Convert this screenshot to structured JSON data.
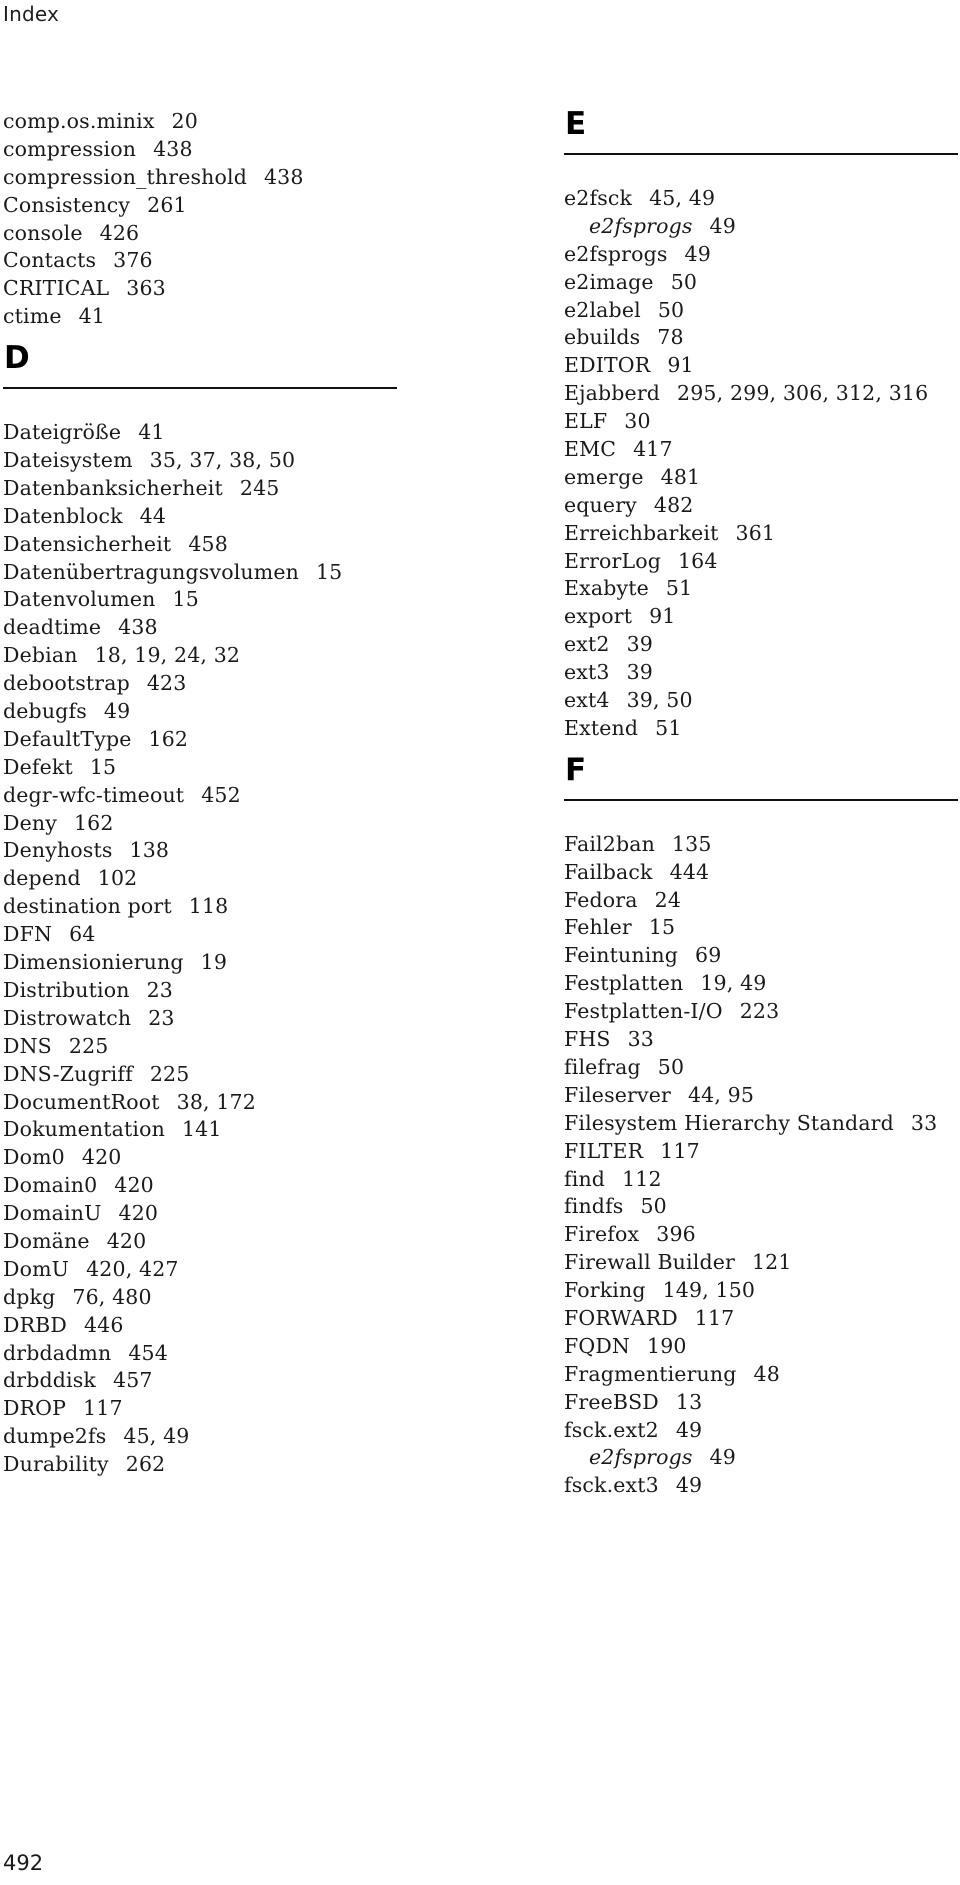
{
  "running_head": "Index",
  "page_number": "492",
  "left_column": {
    "pre_entries": [
      {
        "term": "comp.os.minix",
        "pages": "20"
      },
      {
        "term": "compression",
        "pages": "438"
      },
      {
        "term": "compression_threshold",
        "pages": "438"
      },
      {
        "term": "Consistency",
        "pages": "261"
      },
      {
        "term": "console",
        "pages": "426"
      },
      {
        "term": "Contacts",
        "pages": "376"
      },
      {
        "term": "CRITICAL",
        "pages": "363"
      },
      {
        "term": "ctime",
        "pages": "41"
      }
    ],
    "section": {
      "letter": "D",
      "entries": [
        {
          "term": "Dateigröße",
          "pages": "41"
        },
        {
          "term": "Dateisystem",
          "pages": "35, 37, 38, 50"
        },
        {
          "term": "Datenbanksicherheit",
          "pages": "245"
        },
        {
          "term": "Datenblock",
          "pages": "44"
        },
        {
          "term": "Datensicherheit",
          "pages": "458"
        },
        {
          "term": "Datenübertragungsvolumen",
          "pages": "15"
        },
        {
          "term": "Datenvolumen",
          "pages": "15"
        },
        {
          "term": "deadtime",
          "pages": "438"
        },
        {
          "term": "Debian",
          "pages": "18, 19, 24, 32"
        },
        {
          "term": "debootstrap",
          "pages": "423"
        },
        {
          "term": "debugfs",
          "pages": "49"
        },
        {
          "term": "DefaultType",
          "pages": "162"
        },
        {
          "term": "Defekt",
          "pages": "15"
        },
        {
          "term": "degr-wfc-timeout",
          "pages": "452"
        },
        {
          "term": "Deny",
          "pages": "162"
        },
        {
          "term": "Denyhosts",
          "pages": "138"
        },
        {
          "term": "depend",
          "pages": "102"
        },
        {
          "term": "destination port",
          "pages": "118"
        },
        {
          "term": "DFN",
          "pages": "64"
        },
        {
          "term": "Dimensionierung",
          "pages": "19"
        },
        {
          "term": "Distribution",
          "pages": "23"
        },
        {
          "term": "Distrowatch",
          "pages": "23"
        },
        {
          "term": "DNS",
          "pages": "225"
        },
        {
          "term": "DNS-Zugriff",
          "pages": "225"
        },
        {
          "term": "DocumentRoot",
          "pages": "38, 172"
        },
        {
          "term": "Dokumentation",
          "pages": "141"
        },
        {
          "term": "Dom0",
          "pages": "420"
        },
        {
          "term": "Domain0",
          "pages": "420"
        },
        {
          "term": "DomainU",
          "pages": "420"
        },
        {
          "term": "Domäne",
          "pages": "420"
        },
        {
          "term": "DomU",
          "pages": "420, 427"
        },
        {
          "term": "dpkg",
          "pages": "76, 480"
        },
        {
          "term": "DRBD",
          "pages": "446"
        },
        {
          "term": "drbdadmn",
          "pages": "454"
        },
        {
          "term": "drbddisk",
          "pages": "457"
        },
        {
          "term": "DROP",
          "pages": "117"
        },
        {
          "term": "dumpe2fs",
          "pages": "45, 49"
        },
        {
          "term": "Durability",
          "pages": "262"
        }
      ]
    }
  },
  "right_column": {
    "sections": [
      {
        "letter": "E",
        "entries": [
          {
            "term": "e2fsck",
            "pages": "45, 49"
          },
          {
            "term": "e2fsprogs",
            "pages": "49",
            "sub": true
          },
          {
            "term": "e2fsprogs",
            "pages": "49"
          },
          {
            "term": "e2image",
            "pages": "50"
          },
          {
            "term": "e2label",
            "pages": "50"
          },
          {
            "term": "ebuilds",
            "pages": "78"
          },
          {
            "term": "EDITOR",
            "pages": "91"
          },
          {
            "term": "Ejabberd",
            "pages": "295, 299, 306, 312, 316"
          },
          {
            "term": "ELF",
            "pages": "30"
          },
          {
            "term": "EMC",
            "pages": "417"
          },
          {
            "term": "emerge",
            "pages": "481"
          },
          {
            "term": "equery",
            "pages": "482"
          },
          {
            "term": "Erreichbarkeit",
            "pages": "361"
          },
          {
            "term": "ErrorLog",
            "pages": "164"
          },
          {
            "term": "Exabyte",
            "pages": "51"
          },
          {
            "term": "export",
            "pages": "91"
          },
          {
            "term": "ext2",
            "pages": "39"
          },
          {
            "term": "ext3",
            "pages": "39"
          },
          {
            "term": "ext4",
            "pages": "39, 50"
          },
          {
            "term": "Extend",
            "pages": "51"
          }
        ]
      },
      {
        "letter": "F",
        "entries": [
          {
            "term": "Fail2ban",
            "pages": "135"
          },
          {
            "term": "Failback",
            "pages": "444"
          },
          {
            "term": "Fedora",
            "pages": "24"
          },
          {
            "term": "Fehler",
            "pages": "15"
          },
          {
            "term": "Feintuning",
            "pages": "69"
          },
          {
            "term": "Festplatten",
            "pages": "19, 49"
          },
          {
            "term": "Festplatten-I/O",
            "pages": "223"
          },
          {
            "term": "FHS",
            "pages": "33"
          },
          {
            "term": "filefrag",
            "pages": "50"
          },
          {
            "term": "Fileserver",
            "pages": "44, 95"
          },
          {
            "term": "Filesystem Hierarchy Standard",
            "pages": "33"
          },
          {
            "term": "FILTER",
            "pages": "117"
          },
          {
            "term": "find",
            "pages": "112"
          },
          {
            "term": "findfs",
            "pages": "50"
          },
          {
            "term": "Firefox",
            "pages": "396"
          },
          {
            "term": "Firewall Builder",
            "pages": "121"
          },
          {
            "term": "Forking",
            "pages": "149, 150"
          },
          {
            "term": "FORWARD",
            "pages": "117"
          },
          {
            "term": "FQDN",
            "pages": "190"
          },
          {
            "term": "Fragmentierung",
            "pages": "48"
          },
          {
            "term": "FreeBSD",
            "pages": "13"
          },
          {
            "term": "fsck.ext2",
            "pages": "49"
          },
          {
            "term": "e2fsprogs",
            "pages": "49",
            "sub": true
          },
          {
            "term": "fsck.ext3",
            "pages": "49"
          }
        ]
      }
    ]
  }
}
